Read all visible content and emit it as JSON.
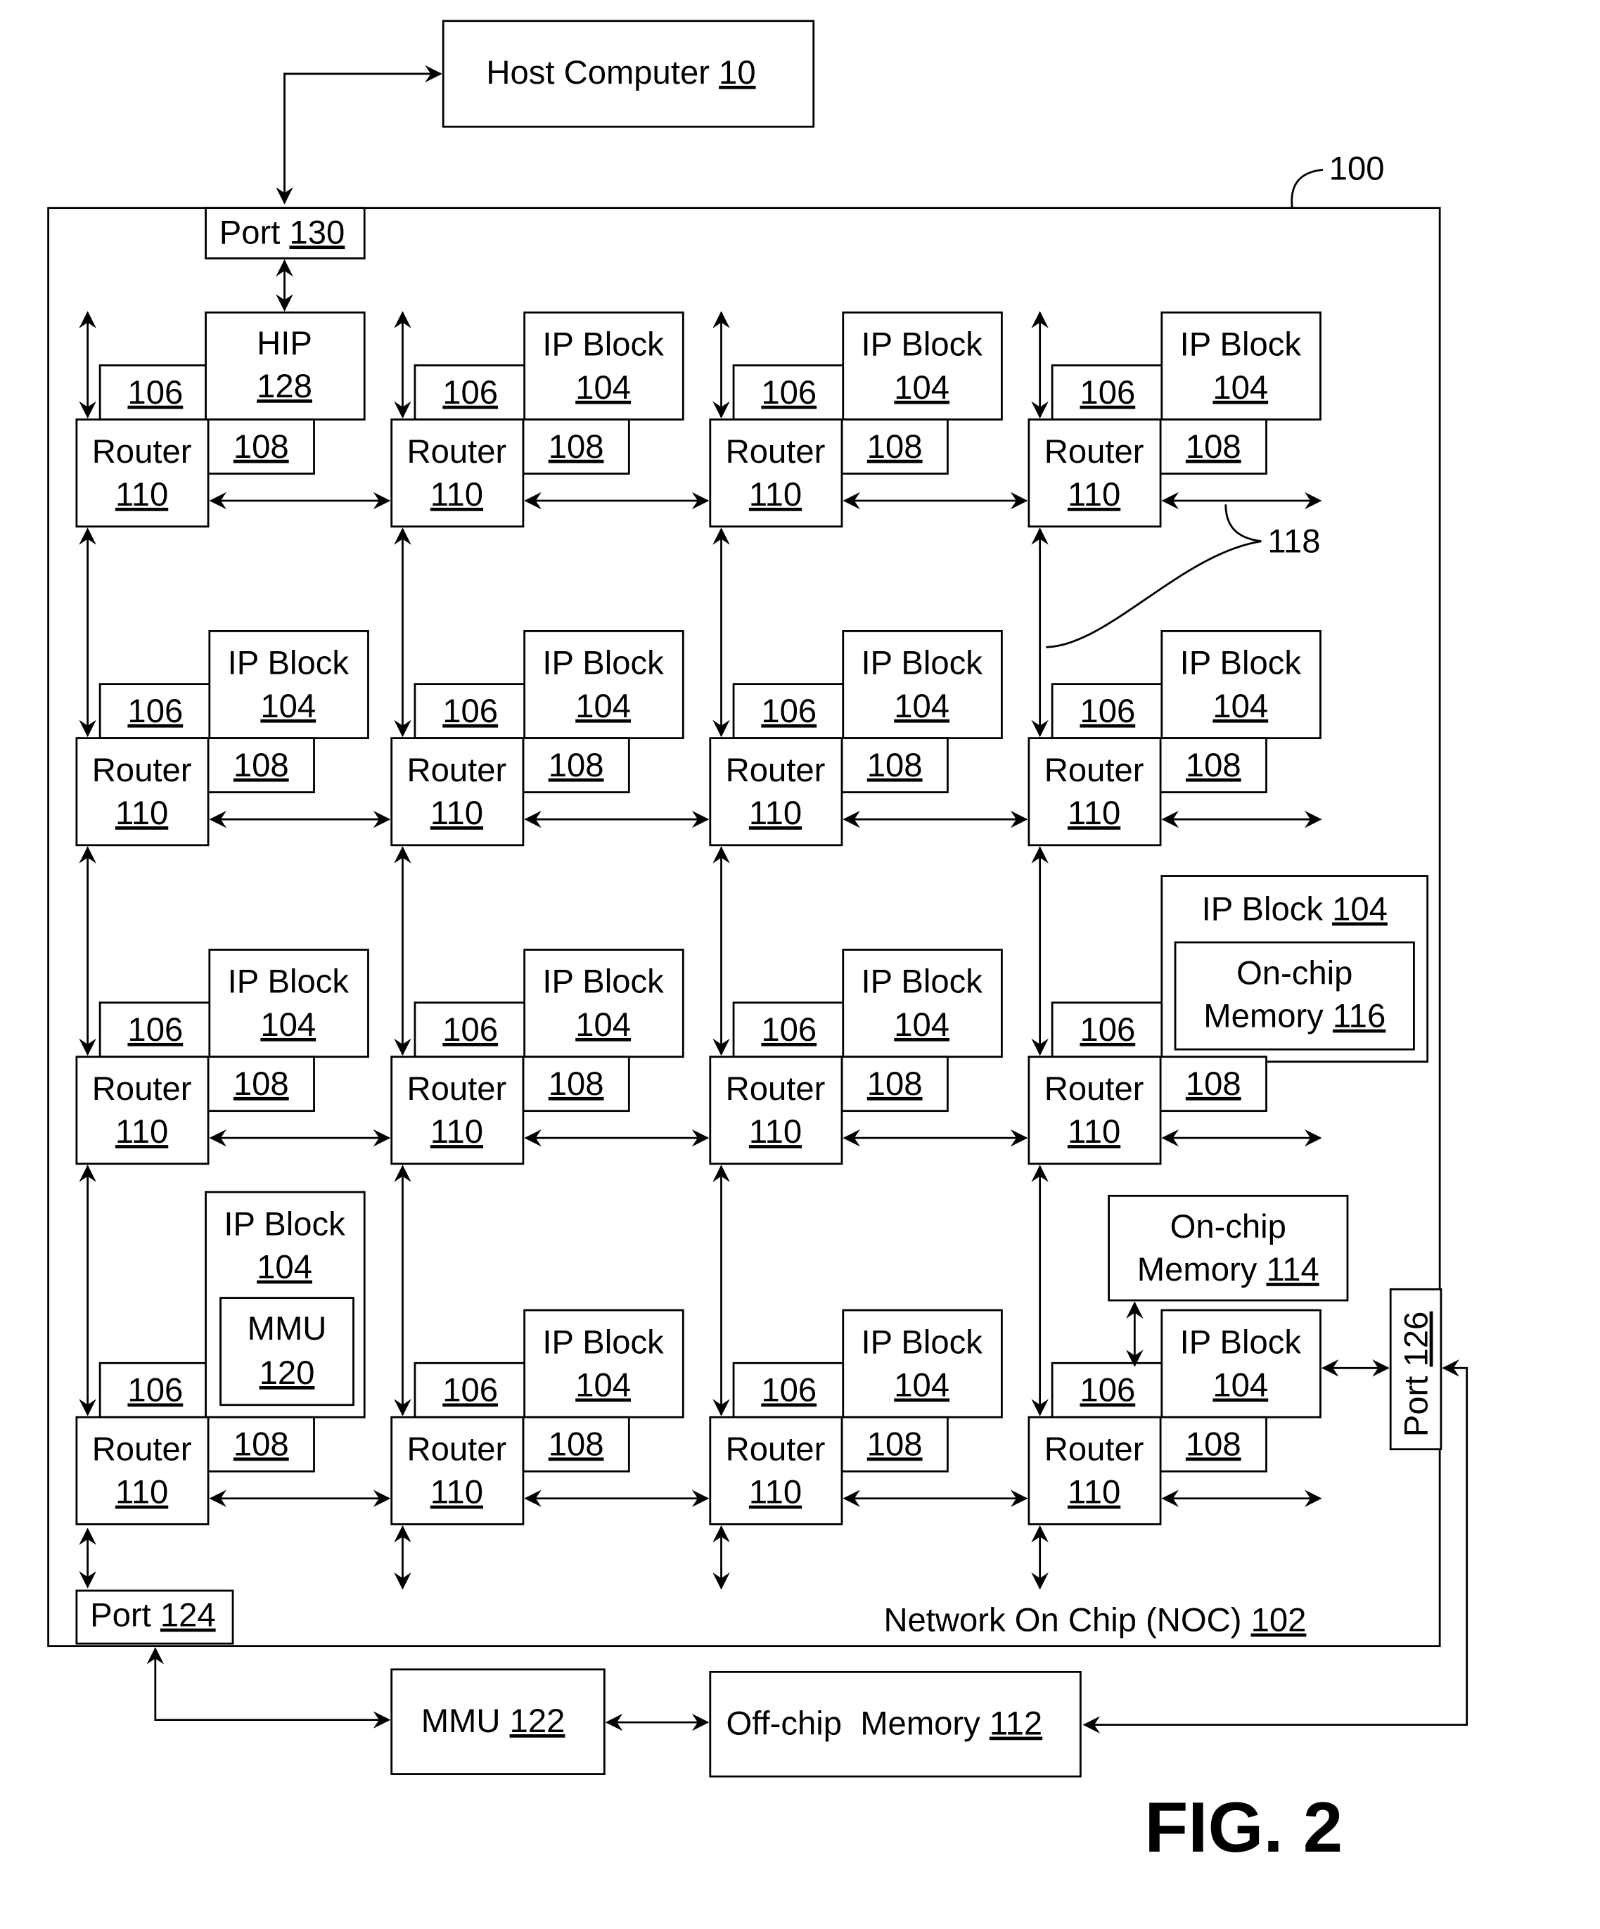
{
  "figure": {
    "label": "FIG. 2",
    "reference": "100"
  },
  "host": {
    "name": "Host Computer",
    "ref": "10"
  },
  "noc": {
    "name": "Network On Chip (NOC)",
    "ref": "102"
  },
  "ports": {
    "port130": {
      "name": "Port",
      "ref": "130"
    },
    "port124": {
      "name": "Port",
      "ref": "124"
    },
    "port126": {
      "name": "Port",
      "ref": "126"
    }
  },
  "external": {
    "mmu122": {
      "name": "MMU",
      "ref": "122"
    },
    "offchip": {
      "name": "Off-chip  Memory",
      "ref": "112"
    }
  },
  "link_ref": "118",
  "node_labels": {
    "router": "Router",
    "router_ref": "110",
    "ni_ref": "106",
    "mc_ref": "108",
    "ip_block": "IP Block",
    "ip_ref": "104"
  },
  "special_blocks": {
    "hip": {
      "name": "HIP",
      "ref": "128"
    },
    "mmu120": {
      "name": "MMU",
      "ref": "120"
    },
    "onchip116": {
      "line1": "On-chip",
      "line2": "Memory",
      "ref": "116"
    },
    "onchip114": {
      "line1": "On-chip",
      "line2": "Memory",
      "ref": "114"
    }
  },
  "grid": {
    "rows": 4,
    "cols": 4,
    "nodes": [
      {
        "row": 0,
        "col": 0,
        "block": "hip"
      },
      {
        "row": 0,
        "col": 1,
        "block": "ip"
      },
      {
        "row": 0,
        "col": 2,
        "block": "ip"
      },
      {
        "row": 0,
        "col": 3,
        "block": "ip"
      },
      {
        "row": 1,
        "col": 0,
        "block": "ip"
      },
      {
        "row": 1,
        "col": 1,
        "block": "ip"
      },
      {
        "row": 1,
        "col": 2,
        "block": "ip"
      },
      {
        "row": 1,
        "col": 3,
        "block": "ip"
      },
      {
        "row": 2,
        "col": 0,
        "block": "ip"
      },
      {
        "row": 2,
        "col": 1,
        "block": "ip"
      },
      {
        "row": 2,
        "col": 2,
        "block": "ip"
      },
      {
        "row": 2,
        "col": 3,
        "block": "ip_onchip116"
      },
      {
        "row": 3,
        "col": 0,
        "block": "ip_mmu120"
      },
      {
        "row": 3,
        "col": 1,
        "block": "ip"
      },
      {
        "row": 3,
        "col": 2,
        "block": "ip"
      },
      {
        "row": 3,
        "col": 3,
        "block": "ip"
      }
    ]
  }
}
